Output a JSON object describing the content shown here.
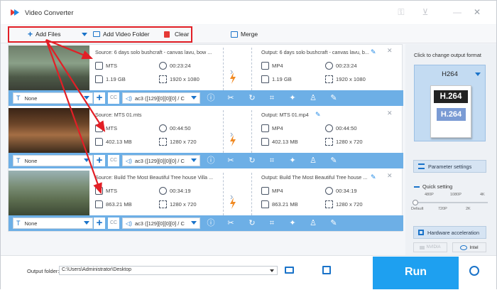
{
  "app": {
    "title": "Video Converter",
    "icons": [
      "app-logo-icon",
      "key-icon",
      "cart-icon",
      "minimize-icon",
      "close-icon"
    ]
  },
  "toolbar": {
    "add_files": "Add Files",
    "add_video_folder": "Add Video Folder",
    "clear": "Clear",
    "merge": "Merge"
  },
  "items": [
    {
      "source_title": "Source: 6 days solo bushcraft - canvas lavu, bow ...",
      "output_title": "Output: 6 days solo bushcraft - canvas lavu, b...",
      "src_format": "MTS",
      "src_duration": "00:23:24",
      "src_size": "1.19 GB",
      "src_res": "1920 x 1080",
      "out_format": "MP4",
      "out_duration": "00:23:24",
      "out_size": "1.19 GB",
      "out_res": "1920 x 1080",
      "subtitle": "None",
      "audio": "ac3 ([129][0][0][0] / C"
    },
    {
      "source_title": "Source: MTS 01.mts",
      "output_title": "Output: MTS 01.mp4",
      "src_format": "MTS",
      "src_duration": "00:44:50",
      "src_size": "402.13 MB",
      "src_res": "1280 x 720",
      "out_format": "MP4",
      "out_duration": "00:44:50",
      "out_size": "402.13 MB",
      "out_res": "1280 x 720",
      "subtitle": "None",
      "audio": "ac3 ([129][0][0][0] / C"
    },
    {
      "source_title": "Source: Build The Most Beautiful Tree house Villa ...",
      "output_title": "Output: Build The Most Beautiful Tree house ...",
      "src_format": "MTS",
      "src_duration": "00:34:19",
      "src_size": "863.21 MB",
      "src_res": "1280 x 720",
      "out_format": "MP4",
      "out_duration": "00:34:19",
      "out_size": "863.21 MB",
      "out_res": "1280 x 720",
      "subtitle": "None",
      "audio": "ac3 ([129][0][0][0] / C"
    }
  ],
  "sidebar": {
    "change_format_label": "Click to change output format",
    "format_name": "H264",
    "format_badge_top": "H.264",
    "format_badge_bottom": "H.264",
    "parameter_settings": "Parameter settings",
    "quick_setting": "Quick setting",
    "quality_top": [
      "480P",
      "1080P",
      "4K"
    ],
    "quality_bottom": [
      "Default",
      "720P",
      "2K"
    ],
    "quality_level": 0,
    "hardware_acceleration": "Hardware acceleration",
    "nvidia": "NVIDIA",
    "intel": "Intel"
  },
  "footer": {
    "output_folder_label": "Output folder:",
    "output_path": "C:\\Users\\Administrator\\Desktop",
    "run": "Run"
  },
  "colors": {
    "accent": "#1ea0f0",
    "bar": "#6dafe6",
    "annotation": "#e21f26"
  }
}
